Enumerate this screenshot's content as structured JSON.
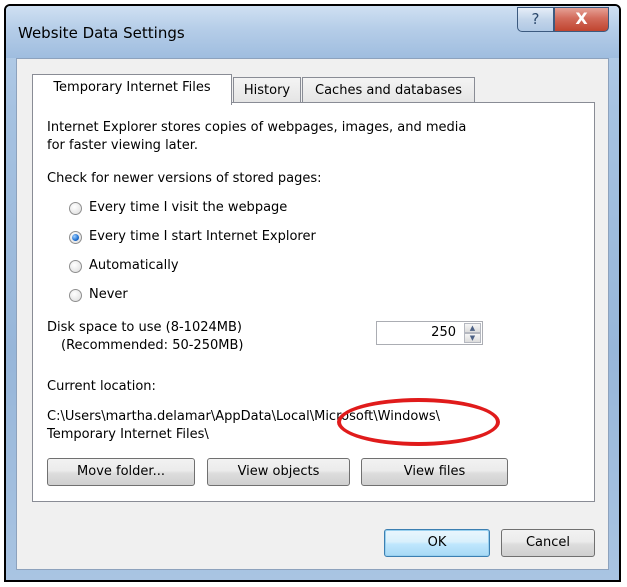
{
  "window": {
    "title": "Website Data Settings",
    "help_glyph": "?",
    "close_glyph": "X"
  },
  "tabs": [
    {
      "label": "Temporary Internet Files",
      "active": true
    },
    {
      "label": "History",
      "active": false
    },
    {
      "label": "Caches and databases",
      "active": false
    }
  ],
  "panel": {
    "description_line1": "Internet Explorer stores copies of webpages, images, and media",
    "description_line2": "for faster viewing later.",
    "check_label": "Check for newer versions of stored pages:",
    "options": [
      {
        "label": "Every time I visit the webpage",
        "selected": false
      },
      {
        "label": "Every time I start Internet Explorer",
        "selected": true
      },
      {
        "label": "Automatically",
        "selected": false
      },
      {
        "label": "Never",
        "selected": false
      }
    ],
    "disk_label_line1": "Disk space to use (8-1024MB)",
    "disk_label_line2": "(Recommended: 50-250MB)",
    "disk_value": "250",
    "current_location_label": "Current location:",
    "location_line1": "C:\\Users\\martha.delamar\\AppData\\Local\\Microsoft\\Windows\\",
    "location_line2": "Temporary Internet Files\\",
    "buttons": {
      "move_folder": "Move folder...",
      "view_objects": "View objects",
      "view_files": "View files"
    }
  },
  "footer": {
    "ok": "OK",
    "cancel": "Cancel"
  },
  "colors": {
    "highlight_ring": "#e01b1b",
    "radio_selected": "#1e6fd0"
  }
}
